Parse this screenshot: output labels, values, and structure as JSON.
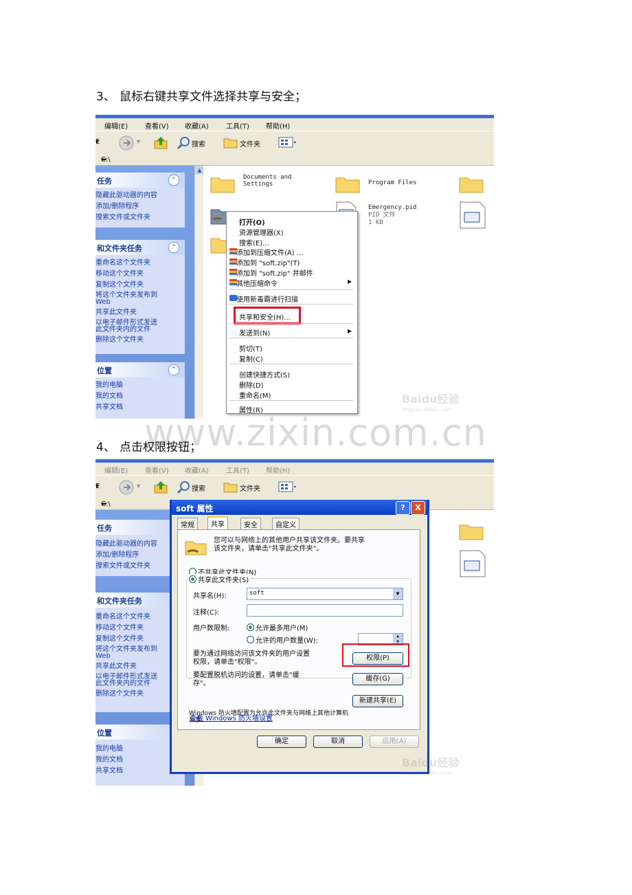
{
  "step3": {
    "number": "3、",
    "text": "鼠标右键共享文件选择共享与安全；"
  },
  "step4": {
    "number": "4、",
    "text": "点击权限按钮；"
  },
  "watermark": "www.zixin.com.cn",
  "explorer": {
    "menu": [
      "编辑(E)",
      "查看(V)",
      "收藏(A)",
      "工具(T)",
      "帮助(H)"
    ],
    "toolbar": {
      "back_label": "E",
      "search_label": "搜索",
      "folders_label": "文件夹"
    },
    "address": "C:\\",
    "left_panes": [
      {
        "title": "任务",
        "items": [
          "隐藏此驱动器的内容",
          "添加/删除程序",
          "搜索文件或文件夹"
        ]
      },
      {
        "title": "和文件夹任务",
        "items": [
          "重命名这个文件夹",
          "移动这个文件夹",
          "复制这个文件夹",
          "将这个文件夹发布到\nWeb",
          "共享此文件夹",
          "以电子邮件形式发送\n此文件夹内的文件",
          "删除这个文件夹"
        ]
      },
      {
        "title": "位置",
        "items": [
          "我的电脑",
          "我的文档",
          "共享文档"
        ]
      }
    ],
    "files": {
      "docs_and_settings": "Documents and\nSettings",
      "program_files": "Program Files",
      "emergency_name": "Emergency.pid",
      "emergency_type": "PID 文件",
      "emergency_size": "1 KB"
    }
  },
  "context_menu": {
    "items": [
      "打开(O)",
      "资源管理器(X)",
      "搜索(E)...",
      "添加到压缩文件(A) ...",
      "添加到 \"soft.zip\"(T)",
      "添加到 \"soft.zip\" 并邮件",
      "其他压缩命令",
      "使用新毒霸进行扫描",
      "共享和安全(H)...",
      "发送到(N)",
      "剪切(T)",
      "复制(C)",
      "创建快捷方式(S)",
      "删除(D)",
      "重命名(M)",
      "属性(R)"
    ]
  },
  "dialog": {
    "title": "soft 属性",
    "help_btn": "?",
    "close_btn": "X",
    "tabs": [
      "常规",
      "共享",
      "安全",
      "自定义"
    ],
    "intro": "您可以与网络上的其他用户共享该文件夹。要共享\n该文件夹，请单击\"共享此文件夹\"。",
    "no_share": "不共享此文件夹(N)",
    "share": "共享此文件夹(S)",
    "share_name_label": "共享名(H):",
    "share_name_value": "soft",
    "comment_label": "注释(C):",
    "user_limit_label": "用户数限制:",
    "max_users": "允许最多用户(M)",
    "allowed_users": "允许的用户数量(W):",
    "perm_text": "要为通过网络访问该文件夹的用户设置\n权限，请单击\"权限\"。",
    "perm_btn": "权限(P)",
    "cache_text": "要配置脱机访问的设置，请单击\"缓\n存\"。",
    "cache_btn": "缓存(G)",
    "new_share_btn": "新建共享(E)",
    "firewall_text": "Windows 防火墙配置为允许此文件夹与网络上其他计算机\n共享。",
    "firewall_link": "查看 Windows 防火墙设置",
    "ok": "确定",
    "cancel": "取消",
    "apply": "应用(A)"
  },
  "baidu_wm": {
    "logo": "Baidu经验",
    "url": "jingyan.baidu.com"
  },
  "colors": {
    "highlight_red": "#e0101a",
    "xp_blue": "#0a40c8"
  }
}
